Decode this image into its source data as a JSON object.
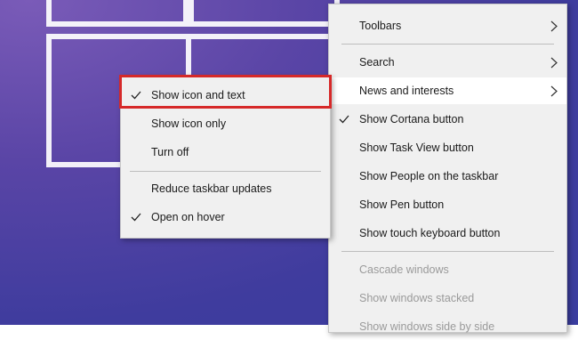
{
  "context_menu": {
    "items": [
      {
        "label": "Toolbars",
        "has_submenu": true
      },
      {
        "label": "Search",
        "has_submenu": true
      },
      {
        "label": "News and interests",
        "has_submenu": true,
        "hovered": true
      },
      {
        "label": "Show Cortana button",
        "checked": true
      },
      {
        "label": "Show Task View button"
      },
      {
        "label": "Show People on the taskbar"
      },
      {
        "label": "Show Pen button"
      },
      {
        "label": "Show touch keyboard button"
      },
      {
        "label": "Cascade windows",
        "disabled": true
      },
      {
        "label": "Show windows stacked",
        "disabled": true
      },
      {
        "label": "Show windows side by side",
        "disabled": true
      }
    ]
  },
  "submenu": {
    "items": [
      {
        "label": "Show icon and text",
        "checked": true,
        "highlighted": true
      },
      {
        "label": "Show icon only"
      },
      {
        "label": "Turn off"
      },
      {
        "label": "Reduce taskbar updates"
      },
      {
        "label": "Open on hover",
        "checked": true
      }
    ]
  },
  "colors": {
    "highlight_border": "#d62929",
    "menu_background": "#f0f0f0"
  }
}
